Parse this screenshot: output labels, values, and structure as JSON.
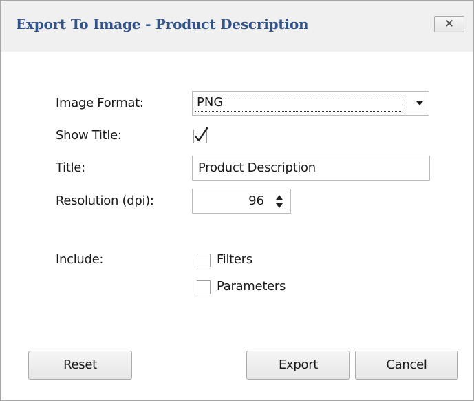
{
  "dialog": {
    "title": "Export To Image - Product Description",
    "close_glyph": "✕"
  },
  "form": {
    "image_format": {
      "label": "Image Format:",
      "value": "PNG"
    },
    "show_title": {
      "label": "Show Title:",
      "checked": true
    },
    "title": {
      "label": "Title:",
      "value": "Product Description"
    },
    "resolution": {
      "label": "Resolution (dpi):",
      "value": "96"
    },
    "include": {
      "label": "Include:",
      "options": [
        {
          "label": "Filters",
          "checked": false
        },
        {
          "label": "Parameters",
          "checked": false
        }
      ]
    }
  },
  "buttons": {
    "reset": "Reset",
    "export": "Export",
    "cancel": "Cancel"
  },
  "colors": {
    "title_text": "#33548a",
    "titlebar_bg": "#f0f0f0",
    "window_border": "#a6a6a6"
  },
  "icons": {
    "close": "close-icon",
    "dropdown": "chevron-down-icon",
    "checkmark": "checkmark-icon",
    "spin_up": "arrow-up-icon",
    "spin_down": "arrow-down-icon"
  }
}
